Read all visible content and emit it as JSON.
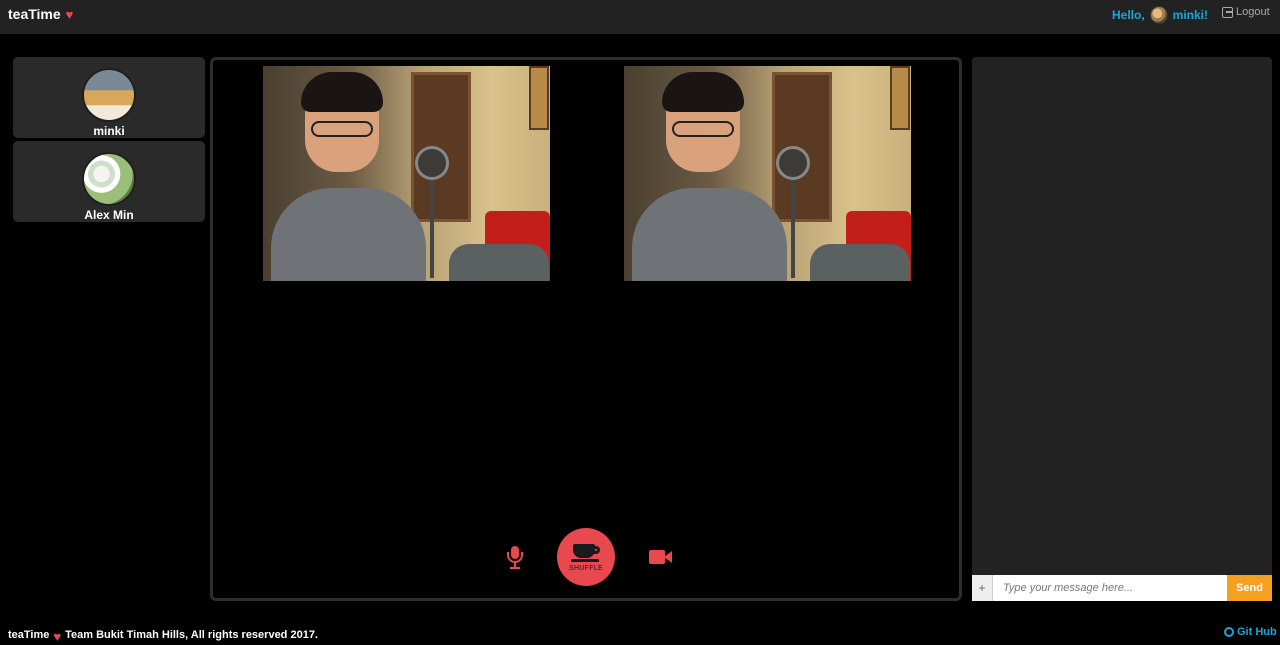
{
  "header": {
    "brand": "teaTime",
    "heart": "♥",
    "greeting": "Hello,",
    "username": "minki!",
    "logout_label": "Logout"
  },
  "sidebar": {
    "users": [
      {
        "name": "minki"
      },
      {
        "name": "Alex Min"
      }
    ]
  },
  "controls": {
    "shuffle_label": "SHUFFLE"
  },
  "chat": {
    "plus_label": "+",
    "placeholder": "Type your message here...",
    "send_label": "Send"
  },
  "footer": {
    "brand": "teaTime",
    "heart": "♥",
    "credit": "Team Bukit Timah Hills, All rights reserved 2017.",
    "github_label": "Git Hub"
  },
  "colors": {
    "accent": "#e8494f",
    "link": "#1aa6d8",
    "send": "#f5a11f"
  }
}
